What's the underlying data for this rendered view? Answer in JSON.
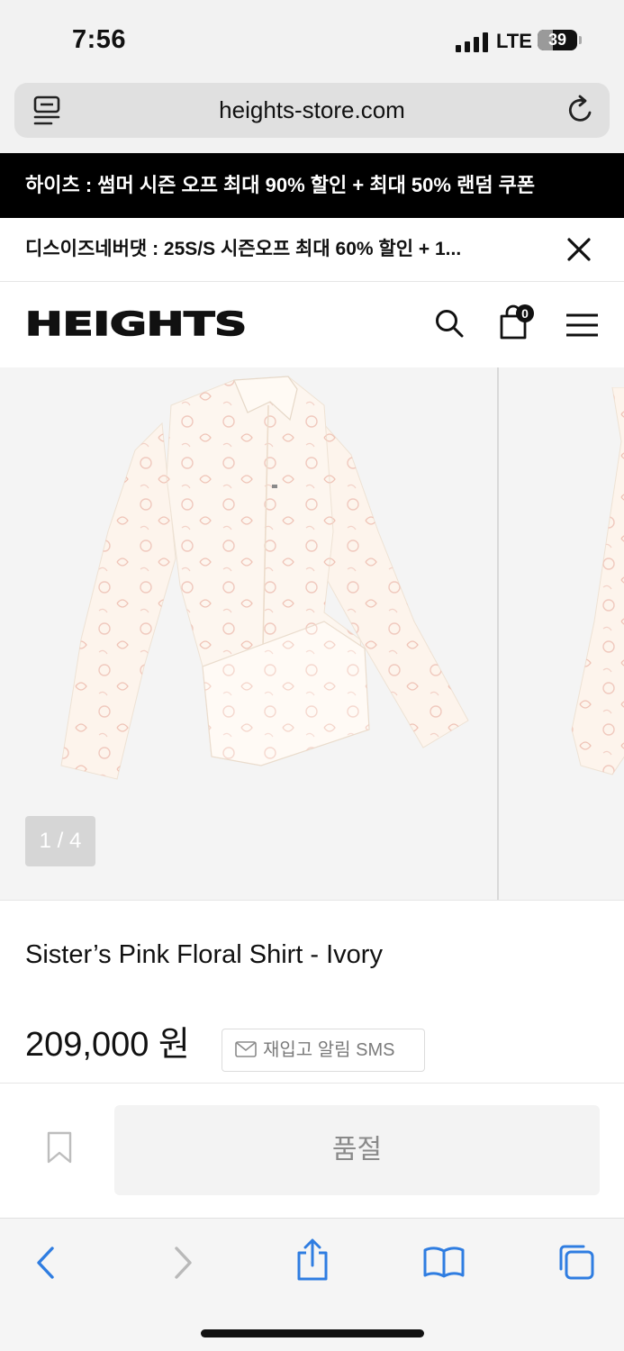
{
  "status_bar": {
    "time": "7:56",
    "network": "LTE",
    "battery": "39",
    "battery_level": 0.39
  },
  "browser": {
    "url": "heights-store.com"
  },
  "banners": {
    "primary": "하이츠 : 썸머 시즌 오프 최대 90% 할인 + 최대 50% 랜덤 쿠폰",
    "secondary": "디스이즈네버댓 : 25S/S 시즌오프 최대 60% 할인 + 1..."
  },
  "header": {
    "logo": "HEIGHTS",
    "cart_count": "0"
  },
  "gallery": {
    "counter": "1 / 4",
    "current_index": 1,
    "total": 4
  },
  "product": {
    "name": "Sister’s Pink Floral Shirt - Ivory",
    "price": "209,000 원",
    "restock_label": "재입고 알림 SMS",
    "soldout_label": "품절"
  },
  "colors": {
    "accent_blue": "#2f7de1",
    "banner_black": "#000000",
    "soldout_bg": "#f3f3f3"
  },
  "icons": {
    "reader": "reader-icon",
    "reload": "reload-icon",
    "close": "close-icon",
    "search": "search-icon",
    "cart": "shopping-bag-icon",
    "menu": "menu-icon",
    "bookmark": "bookmark-icon",
    "back": "back-arrow-icon",
    "forward": "forward-arrow-icon",
    "share": "share-icon",
    "bookmarks": "bookmarks-book-icon",
    "tabs": "tabs-icon"
  }
}
